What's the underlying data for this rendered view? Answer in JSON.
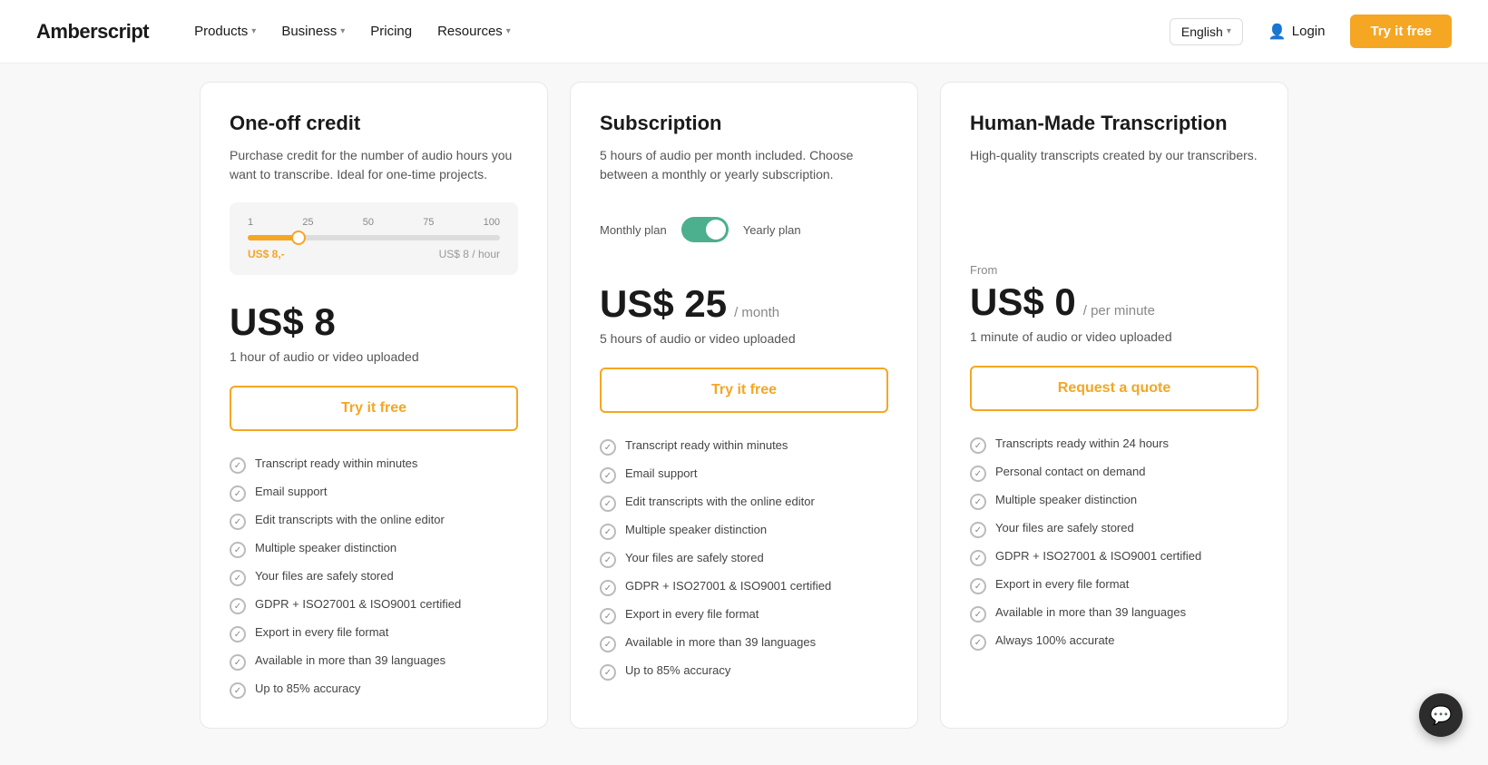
{
  "brand": {
    "logo_text": "Amberscript",
    "logo_highlight": ""
  },
  "navbar": {
    "products_label": "Products",
    "business_label": "Business",
    "pricing_label": "Pricing",
    "resources_label": "Resources",
    "language_label": "English",
    "login_label": "Login",
    "try_label": "Try it free"
  },
  "cards": [
    {
      "title": "One-off credit",
      "description": "Purchase credit for the number of audio hours you want to transcribe. Ideal for one-time projects.",
      "slider": {
        "ticks": [
          "1",
          "25",
          "50",
          "75",
          "100"
        ],
        "price": "US$ 8,-",
        "unit": "US$ 8 / hour"
      },
      "price_from": null,
      "price_main": "US$ 8",
      "price_period": "",
      "price_desc": "1 hour of audio or video uploaded",
      "cta_label": "Try it free",
      "features": [
        "Transcript ready within minutes",
        "Email support",
        "Edit transcripts with the online editor",
        "Multiple speaker distinction",
        "Your files are safely stored",
        "GDPR + ISO27001 & ISO9001 certified",
        "Export in every file format",
        "Available in more than 39 languages",
        "Up to 85% accuracy"
      ]
    },
    {
      "title": "Subscription",
      "description": "5 hours of audio per month included. Choose between a monthly or yearly subscription.",
      "toggle": {
        "monthly_label": "Monthly plan",
        "yearly_label": "Yearly plan"
      },
      "price_from": null,
      "price_main": "US$ 25",
      "price_period": "/ month",
      "price_desc": "5 hours of audio or video uploaded",
      "cta_label": "Try it free",
      "features": [
        "Transcript ready within minutes",
        "Email support",
        "Edit transcripts with the online editor",
        "Multiple speaker distinction",
        "Your files are safely stored",
        "GDPR + ISO27001 & ISO9001 certified",
        "Export in every file format",
        "Available in more than 39 languages",
        "Up to 85% accuracy"
      ]
    },
    {
      "title": "Human-Made Transcription",
      "description": "High-quality transcripts created by our transcribers.",
      "price_from": "From",
      "price_main": "US$ 0",
      "price_period": "/ per minute",
      "price_desc": "1 minute of audio or video uploaded",
      "cta_label": "Request a quote",
      "features": [
        "Transcripts ready within 24 hours",
        "Personal contact on demand",
        "Multiple speaker distinction",
        "Your files are safely stored",
        "GDPR + ISO27001 & ISO9001 certified",
        "Export in every file format",
        "Available in more than 39 languages",
        "Always 100% accurate"
      ]
    }
  ],
  "chat": {
    "icon": "💬"
  }
}
